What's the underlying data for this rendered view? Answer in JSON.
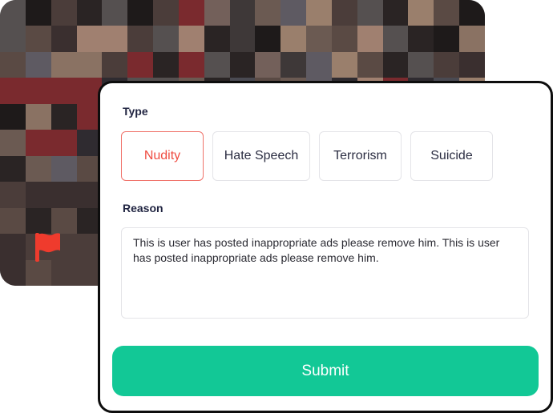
{
  "report": {
    "type_label": "Type",
    "types": [
      {
        "label": "Nudity",
        "selected": true
      },
      {
        "label": "Hate Speech",
        "selected": false
      },
      {
        "label": "Terrorism",
        "selected": false
      },
      {
        "label": "Suicide",
        "selected": false
      }
    ],
    "reason_label": "Reason",
    "reason_text": "This is user has posted inappropriate ads please remove him. This is user has posted inappropriate ads please remove him.",
    "submit_label": "Submit"
  },
  "icons": {
    "flag": "flag-icon"
  },
  "colors": {
    "accent": "#12c896",
    "selected_chip": "#ef4b40",
    "flag": "#ef3b2d",
    "border": "#0d0d0d"
  }
}
